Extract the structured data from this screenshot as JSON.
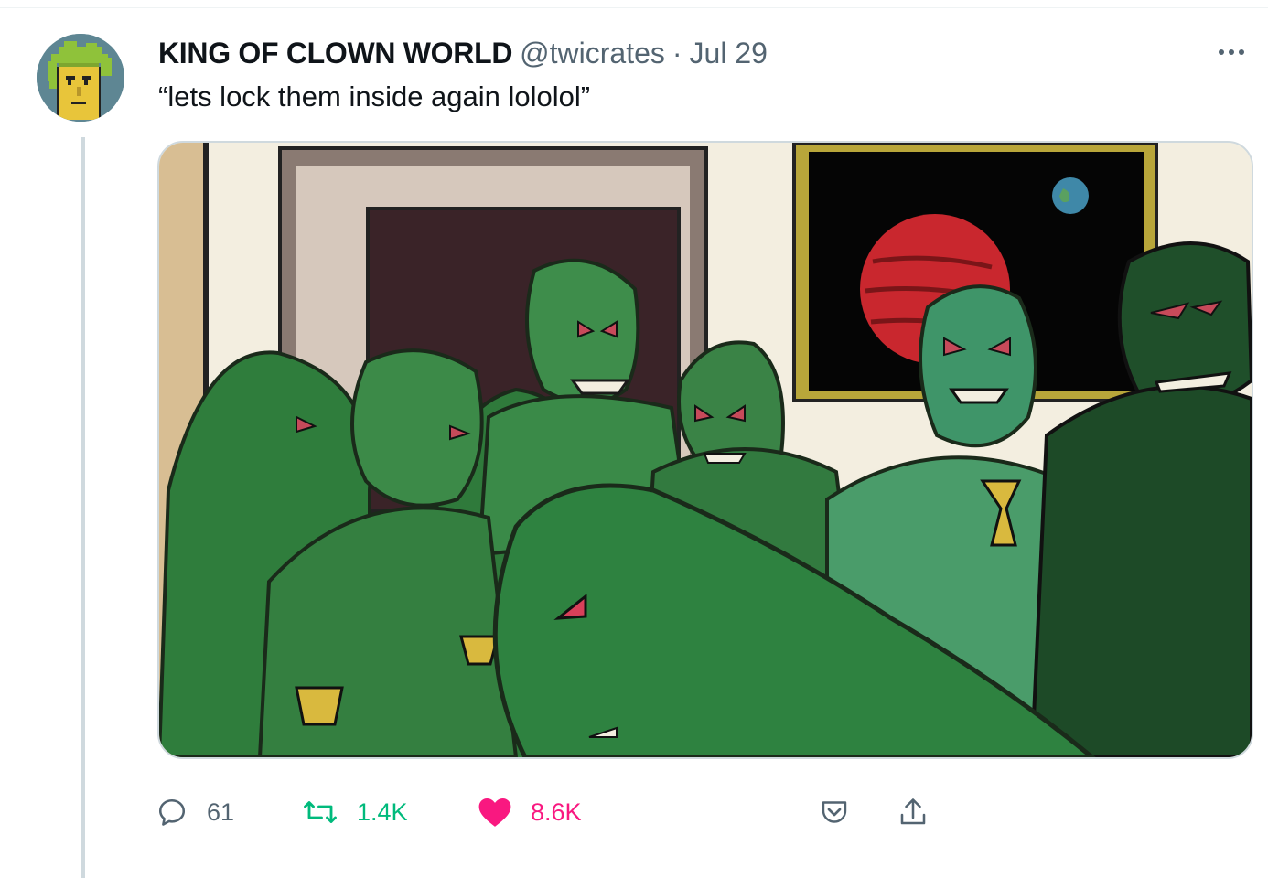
{
  "tweet": {
    "author_name": "KING OF CLOWN WORLD",
    "handle": "@twicrates",
    "separator": "·",
    "date": "Jul 29",
    "text": "“lets lock them inside again lololol”"
  },
  "actions": {
    "reply_count": "61",
    "retweet_count": "1.4K",
    "like_count": "8.6K"
  },
  "icons": {
    "more": "more-dots-icon",
    "reply": "reply-icon",
    "retweet": "retweet-icon",
    "like": "heart-icon",
    "share": "share-pocket-icon",
    "export": "export-upload-icon"
  },
  "colors": {
    "text_primary": "#0f1419",
    "text_secondary": "#536471",
    "retweet_active": "#00ba7c",
    "like_active": "#f91880",
    "border": "#cfd9de"
  }
}
